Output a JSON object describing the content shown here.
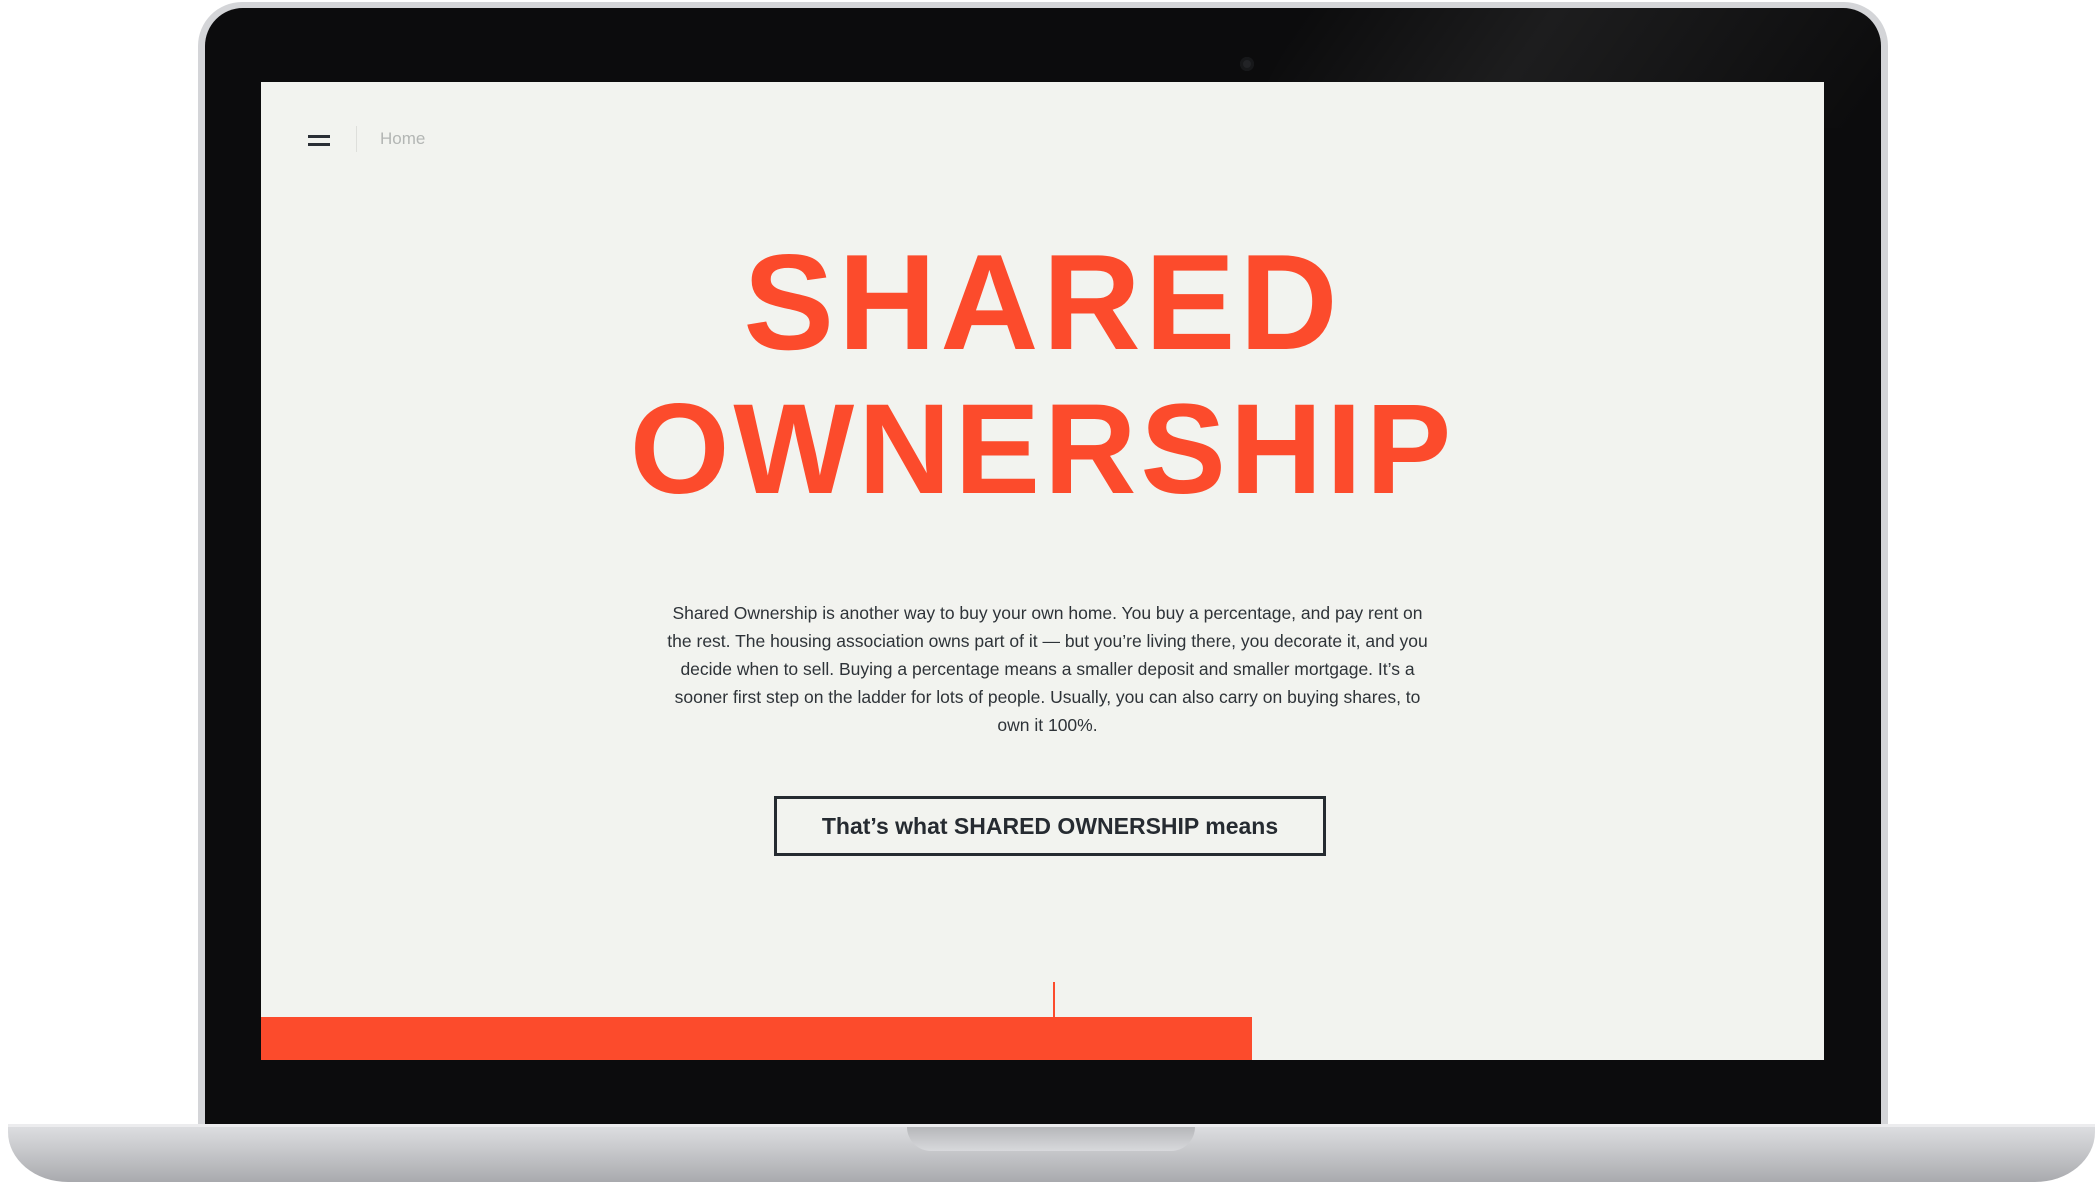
{
  "nav": {
    "menu_icon": "hamburger-menu-icon",
    "breadcrumb": "Home"
  },
  "hero": {
    "title_line1": "SHARED",
    "title_line2": "OWNERSHIP",
    "intro": "Shared Ownership is another way to buy your own home. You buy a percentage, and pay rent on the rest. The housing association owns part of it — but you’re living there, you decorate it, and you decide when to sell. Buying a percentage means a smaller deposit and smaller mortgage. It’s a sooner first step on the ladder for lots of people. Usually, you can also carry on buying shares, to own it 100%.",
    "cta_label": "That’s what SHARED OWNERSHIP means"
  },
  "progress": {
    "fraction": 0.634
  },
  "colors": {
    "accent": "#fc4b2c",
    "ink": "#262b31",
    "screen_bg": "#f2f3ef",
    "muted": "#b3b6b4"
  }
}
